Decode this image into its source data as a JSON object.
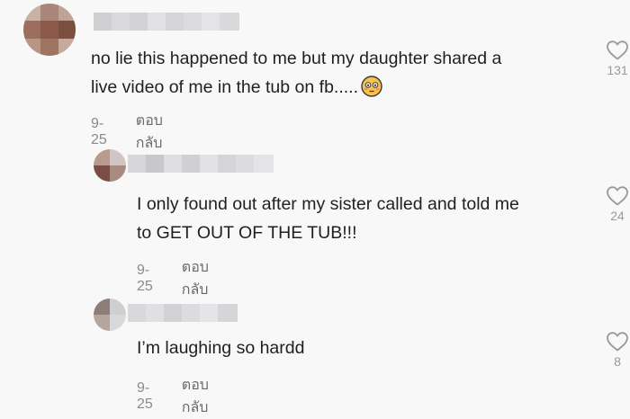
{
  "comments": [
    {
      "text_lines": [
        "no lie this happened to me but my daughter shared a",
        "live video of me in the tub on fb....."
      ],
      "emoji": "flushed-face",
      "date": "9-25",
      "reply_label": "ตอบกลับ",
      "likes": "131"
    },
    {
      "text_lines": [
        "I only found out after my sister called and told me",
        "to GET OUT OF THE TUB!!!"
      ],
      "date": "9-25",
      "reply_label": "ตอบกลับ",
      "likes": "24"
    },
    {
      "text_lines": [
        "I’m laughing so hardd"
      ],
      "date": "9-25",
      "reply_label": "ตอบกลับ",
      "likes": "8"
    }
  ],
  "colors": {
    "background": "#f8f8f8",
    "text": "#1f1f1f",
    "meta": "#8a8a8a",
    "icon": "#9a9a9a"
  }
}
